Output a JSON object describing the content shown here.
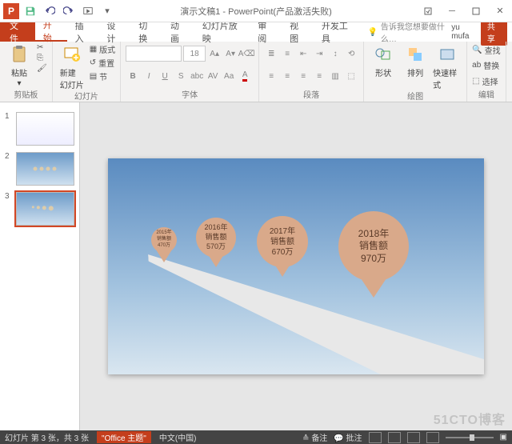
{
  "title": "演示文稿1 - PowerPoint(产品激活失败)",
  "qat": {
    "app_letter": "P"
  },
  "tabs": {
    "file": "文件",
    "home": "开始",
    "insert": "插入",
    "design": "设计",
    "transitions": "切换",
    "animations": "动画",
    "slideshow": "幻灯片放映",
    "review": "审阅",
    "view": "视图",
    "developer": "开发工具",
    "tellme": "告诉我您想要做什么…",
    "user": "yu mufa",
    "share": "共享"
  },
  "ribbon": {
    "clipboard": {
      "paste": "粘贴",
      "label": "剪贴板"
    },
    "slides": {
      "new_slide": "新建\n幻灯片",
      "layout": "版式",
      "reset": "重置",
      "section": "节",
      "label": "幻灯片"
    },
    "font": {
      "size": "18",
      "label": "字体"
    },
    "paragraph": {
      "label": "段落"
    },
    "drawing": {
      "shapes": "形状",
      "arrange": "排列",
      "quickstyles": "快速样式",
      "label": "绘图"
    },
    "editing": {
      "find": "查找",
      "replace": "替换",
      "select": "选择",
      "label": "编辑"
    }
  },
  "thumbs": {
    "n1": "1",
    "n2": "2",
    "n3": "3"
  },
  "chart_data": {
    "type": "bar",
    "title": "",
    "categories": [
      "2015年",
      "2016年",
      "2017年",
      "2018年"
    ],
    "series": [
      {
        "name": "销售额",
        "values": [
          470,
          570,
          670,
          970
        ],
        "unit": "万"
      }
    ]
  },
  "pins": [
    {
      "year_label": "2015年",
      "metric_label": "销售额",
      "value_label": "470万"
    },
    {
      "year_label": "2016年",
      "metric_label": "销售额",
      "value_label": "570万"
    },
    {
      "year_label": "2017年",
      "metric_label": "销售额",
      "value_label": "670万"
    },
    {
      "year_label": "2018年",
      "metric_label": "销售额",
      "value_label": "970万"
    }
  ],
  "status": {
    "slide_of": "幻灯片 第 3 张，共 3 张",
    "theme": "\"Office 主题\"",
    "lang": "中文(中国)",
    "notes": "备注",
    "comments": "批注"
  },
  "watermark": "51CTO博客"
}
